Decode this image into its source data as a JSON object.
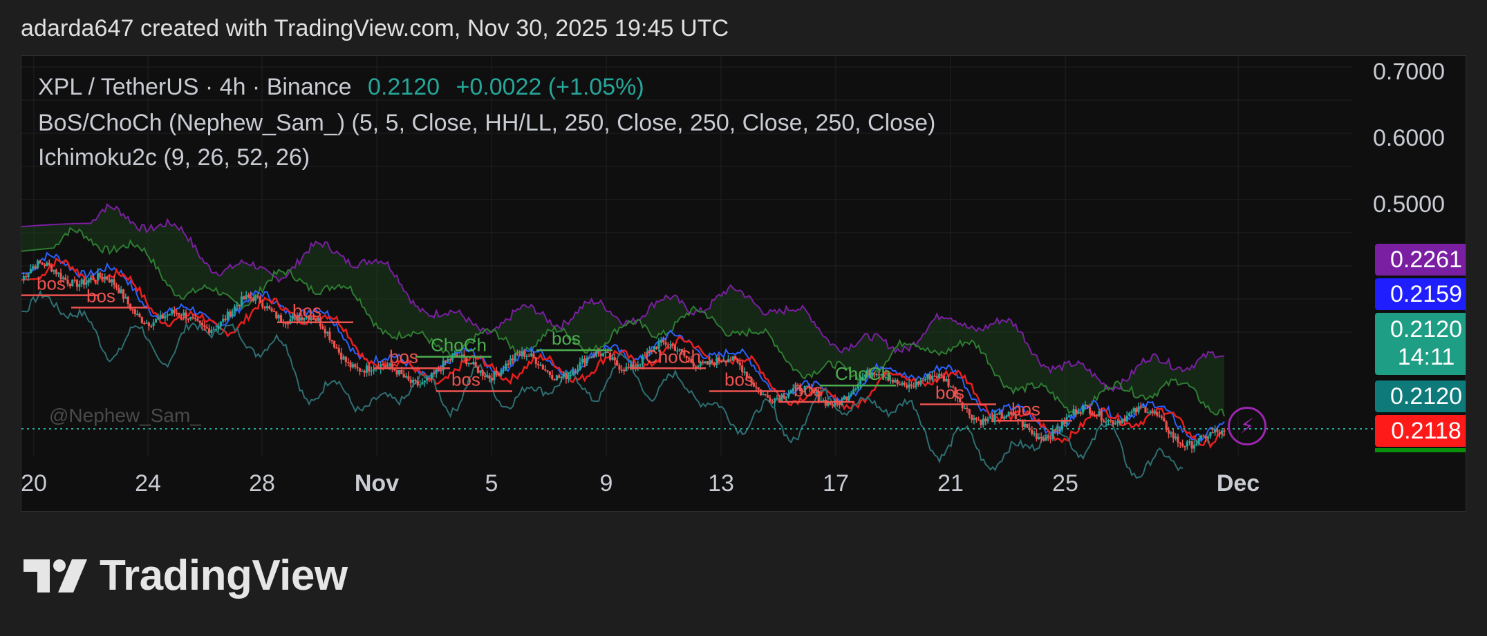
{
  "header": {
    "caption": "adarda647 created with TradingView.com, Nov 30, 2025 19:45 UTC"
  },
  "legend": {
    "symbol": "XPL / TetherUS · 4h · Binance",
    "last_price": "0.2120",
    "change": "+0.0022 (+1.05%)",
    "bos_indicator": "BoS/ChoCh (Nephew_Sam_) (5, 5, Close, HH/LL, 250, Close, 250, Close, 250, Close)",
    "ichimoku": "Ichimoku2c (9, 26, 52, 26)"
  },
  "watermark": "@Nephew_Sam_",
  "price_axis": {
    "labels": [
      "0.7000",
      "0.6000",
      "0.5000"
    ]
  },
  "price_tags": [
    {
      "text": "0.2261",
      "color": "#7b1fa2"
    },
    {
      "text": "0.2159",
      "color": "#1e1eff"
    },
    {
      "text": "0.2120",
      "sub": "14:11",
      "color": "#1e9e84"
    },
    {
      "text": "0.2120",
      "color": "#0e7a7a"
    },
    {
      "text": "0.2118",
      "color": "#ff1a1a"
    }
  ],
  "time_axis": {
    "labels": [
      "20",
      "24",
      "28",
      "Nov",
      "5",
      "9",
      "13",
      "17",
      "21",
      "25",
      "Dec"
    ]
  },
  "chart_labels": {
    "bos": "bos",
    "choch": "ChoCh"
  },
  "colors": {
    "up": "#26a69a",
    "down": "#ef5350",
    "tenkan": "#2962ff",
    "kijun": "#e91e1e",
    "span_a": "#2e7d32",
    "span_b": "#7b1fa2",
    "chikou": "#2e6f73"
  },
  "footer": {
    "brand": "TradingView"
  },
  "chart_data": {
    "type": "candlestick",
    "title": "XPL / TetherUS · 4h · Binance",
    "x": [
      "Oct 20",
      "Oct 24",
      "Oct 28",
      "Nov 1",
      "Nov 5",
      "Nov 9",
      "Nov 13",
      "Nov 17",
      "Nov 21",
      "Nov 25",
      "Nov 30"
    ],
    "close": [
      0.392,
      0.362,
      0.347,
      0.296,
      0.268,
      0.312,
      0.275,
      0.262,
      0.252,
      0.214,
      0.212
    ],
    "ylim": [
      0.18,
      0.75
    ],
    "y_ticks": [
      0.5,
      0.6,
      0.7
    ],
    "annotations": [
      "bos",
      "bos",
      "bos",
      "bos",
      "ChoCh",
      "bos",
      "bos",
      "ChoCh",
      "bos",
      "bos",
      "ChoCh",
      "bos",
      "bos"
    ],
    "last_values": {
      "span_b": 0.2261,
      "tenkan": 0.2159,
      "close": 0.212,
      "kijun": 0.2118
    },
    "grid": true
  }
}
